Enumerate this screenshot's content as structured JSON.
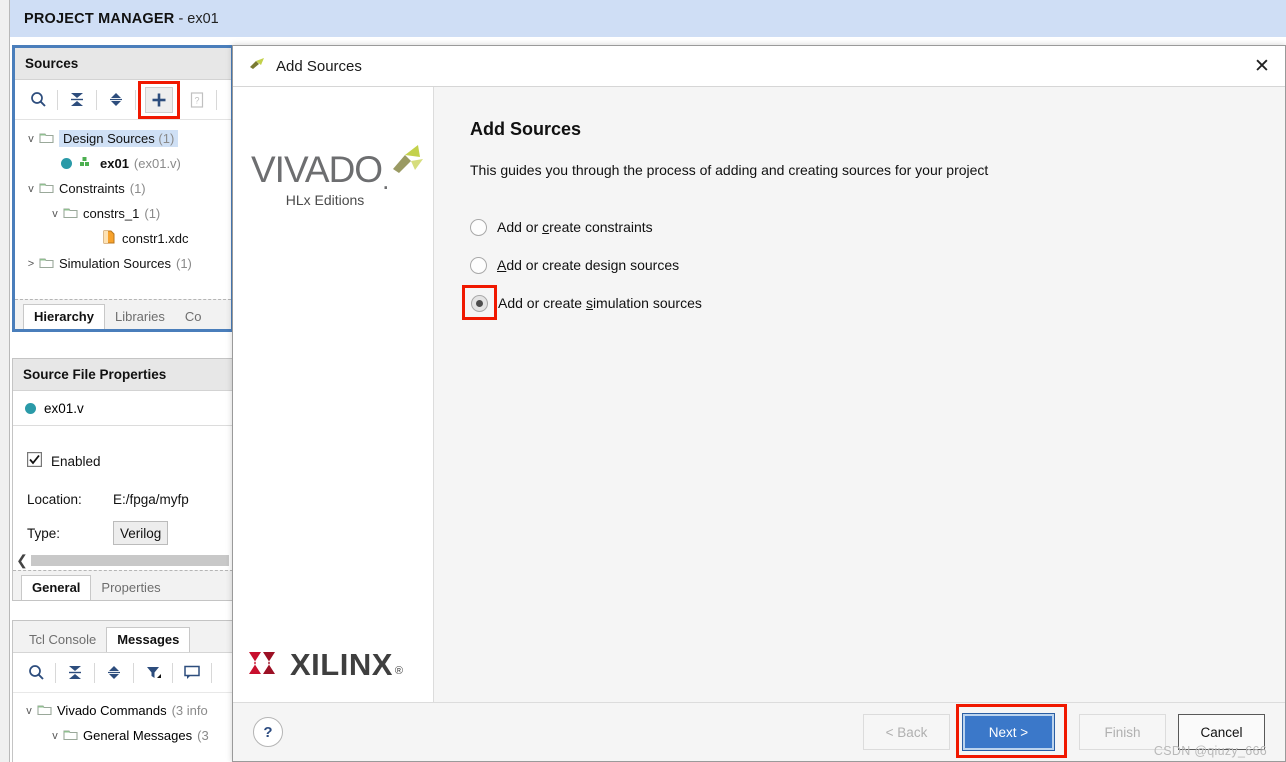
{
  "app": {
    "titlebar": {
      "bold": "PROJECT MANAGER",
      "rest": "- ex01"
    }
  },
  "sources_panel": {
    "header": "Sources",
    "toolbar": [
      {
        "name": "search-icon",
        "label": "Search"
      },
      {
        "name": "collapse-all-icon",
        "label": "Collapse All"
      },
      {
        "name": "expand-collapse-icon",
        "label": "Expand All"
      },
      {
        "name": "add-sources-plus-icon",
        "label": "+"
      },
      {
        "name": "help-doc-icon",
        "label": "?"
      }
    ],
    "tree": [
      {
        "chevron": "v",
        "icon": "folder-icon",
        "label": "Design Sources",
        "count": "(1)",
        "indent": 0,
        "selected": true
      },
      {
        "chevron": "",
        "icon": "verilog-module-icon",
        "label": "ex01",
        "count": "(ex01.v)",
        "indent": 2,
        "bold": true
      },
      {
        "chevron": "v",
        "icon": "folder-icon",
        "label": "Constraints",
        "count": "(1)",
        "indent": 0
      },
      {
        "chevron": "v",
        "icon": "folder-icon",
        "label": "constrs_1",
        "count": "(1)",
        "indent": 1
      },
      {
        "chevron": "",
        "icon": "xdc-file-icon",
        "label": "constr1.xdc",
        "count": "",
        "indent": 3
      },
      {
        "chevron": ">",
        "icon": "folder-icon",
        "label": "Simulation Sources",
        "count": "(1)",
        "indent": 0
      }
    ],
    "tabs": [
      {
        "label": "Hierarchy",
        "active": true
      },
      {
        "label": "Libraries",
        "active": false
      },
      {
        "label": "Co",
        "active": false
      }
    ]
  },
  "properties_panel": {
    "header": "Source File Properties",
    "file_name": "ex01.v",
    "enabled_label": "Enabled",
    "enabled_checked": true,
    "rows": [
      {
        "label": "Location:",
        "value": "E:/fpga/myfp",
        "field": false
      },
      {
        "label": "Type:",
        "value": "Verilog",
        "field": true
      }
    ],
    "tabs": [
      {
        "label": "General",
        "active": true
      },
      {
        "label": "Properties",
        "active": false
      }
    ]
  },
  "console_panel": {
    "tabs": [
      {
        "label": "Tcl Console",
        "active": false
      },
      {
        "label": "Messages",
        "active": true
      }
    ],
    "toolbar": [
      {
        "name": "search-icon"
      },
      {
        "name": "collapse-all-icon"
      },
      {
        "name": "expand-collapse-icon"
      },
      {
        "name": "filter-icon"
      },
      {
        "name": "message-balloon-icon"
      }
    ],
    "tree": [
      {
        "chevron": "v",
        "label": "Vivado Commands",
        "count": "(3 info",
        "indent": 0
      },
      {
        "chevron": "v",
        "label": "General Messages",
        "count": "(3",
        "indent": 1
      }
    ]
  },
  "dialog": {
    "title": "Add Sources",
    "close_label": "✕",
    "sidebar": {
      "vivado_wordmark": "VIVADO",
      "vivado_tagline": "HLx Editions",
      "xilinx_wordmark": "XILINX",
      "xilinx_reg": "®"
    },
    "heading": "Add Sources",
    "subheading": "This guides you through the process of adding and creating sources for your project",
    "options": [
      {
        "pre": "Add or ",
        "mnemonic": "c",
        "post": "reate constraints",
        "checked": false,
        "highlight": false
      },
      {
        "pre": "",
        "mnemonic": "A",
        "post": "dd or create design sources",
        "checked": false,
        "highlight": false
      },
      {
        "pre": "Add or create ",
        "mnemonic": "s",
        "post": "imulation sources",
        "checked": true,
        "highlight": true
      }
    ],
    "footer": {
      "help": "?",
      "buttons": [
        {
          "label": "< Back",
          "state": "disabled",
          "name": "back-button",
          "highlight": false
        },
        {
          "label": "Next >",
          "state": "primary",
          "name": "next-button",
          "highlight": true
        },
        {
          "label": "Finish",
          "state": "disabled",
          "name": "finish-button",
          "highlight": false
        },
        {
          "label": "Cancel",
          "state": "cancel",
          "name": "cancel-button",
          "highlight": false
        }
      ]
    }
  },
  "watermark": "CSDN @qiuzy_666",
  "colors": {
    "titlebar": "#cfdef5",
    "panel_focus_border": "#4a7ebb",
    "highlight_red": "#f01800",
    "primary_button": "#3b78c9",
    "tree_icon_blue": "#2d4d7d",
    "verilog_dot": "#2a9aa8"
  }
}
